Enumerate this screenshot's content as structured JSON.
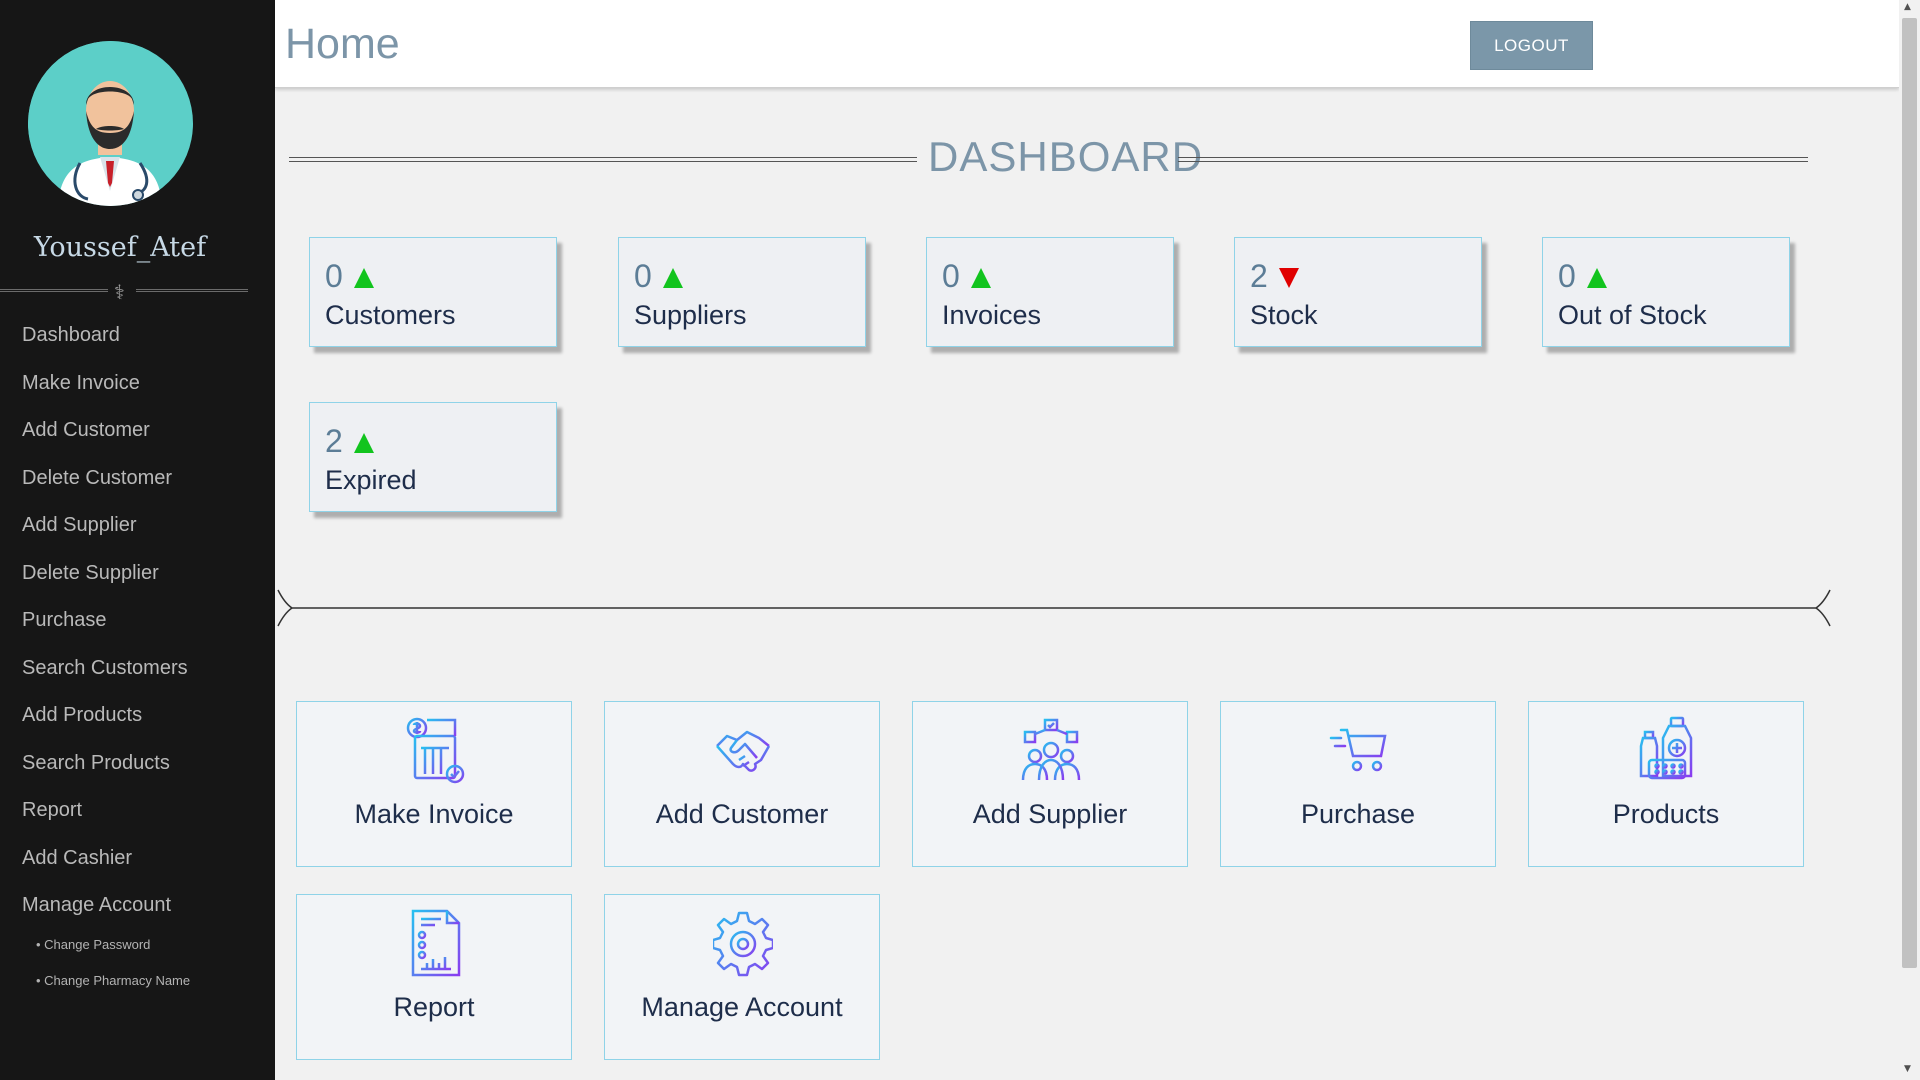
{
  "user": {
    "name": "Youssef_Atef"
  },
  "sidebar": {
    "divider_symbol": "⚕",
    "items": [
      {
        "label": "Dashboard"
      },
      {
        "label": "Make Invoice"
      },
      {
        "label": "Add Customer"
      },
      {
        "label": "Delete Customer"
      },
      {
        "label": "Add Supplier"
      },
      {
        "label": "Delete Supplier"
      },
      {
        "label": "Purchase"
      },
      {
        "label": "Search Customers"
      },
      {
        "label": "Add Products"
      },
      {
        "label": "Search Products"
      },
      {
        "label": "Report"
      },
      {
        "label": "Add Cashier"
      },
      {
        "label": "Manage Account"
      }
    ],
    "subitems": [
      {
        "label": "• Change Password"
      },
      {
        "label": "• Change Pharmacy Name"
      }
    ]
  },
  "header": {
    "title": "Home",
    "logout_label": "LOGOUT"
  },
  "dashboard": {
    "title": "DASHBOARD",
    "stats": [
      {
        "value": "0",
        "label": "Customers",
        "trend": "up"
      },
      {
        "value": "0",
        "label": "Suppliers",
        "trend": "up"
      },
      {
        "value": "0",
        "label": "Invoices",
        "trend": "up"
      },
      {
        "value": "2",
        "label": "Stock",
        "trend": "down"
      },
      {
        "value": "0",
        "label": "Out of Stock",
        "trend": "up"
      },
      {
        "value": "2",
        "label": "Expired",
        "trend": "up"
      }
    ]
  },
  "actions": [
    {
      "label": "Make Invoice",
      "icon": "invoice-icon"
    },
    {
      "label": "Add Customer",
      "icon": "handshake-icon"
    },
    {
      "label": "Add Supplier",
      "icon": "team-icon"
    },
    {
      "label": "Purchase",
      "icon": "cart-icon"
    },
    {
      "label": "Products",
      "icon": "medicine-icon"
    },
    {
      "label": "Report",
      "icon": "report-icon"
    },
    {
      "label": "Manage Account",
      "icon": "gear-icon"
    }
  ],
  "colors": {
    "accent": "#7c95a8",
    "sidebar_bg": "#161616",
    "card_border": "#8fd3e8",
    "trend_up": "#12c41e",
    "trend_down": "#e00000"
  }
}
